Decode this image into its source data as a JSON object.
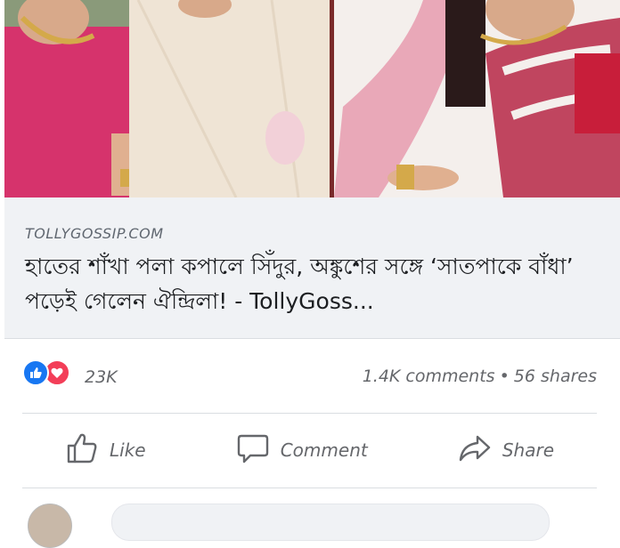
{
  "link_preview": {
    "domain": "TOLLYGOSSIP.COM",
    "headline": "হাতের শাঁখা পলা কপালে সিঁদুর, অঙ্কুশের সঙ্গে ‘সাতপাকে বাঁধা’ পড়েই গেলেন ঐন্দ্রিলা! - TollyGoss..."
  },
  "reactions": {
    "icons": [
      "like-icon",
      "love-icon"
    ],
    "count": "23K"
  },
  "stats": {
    "comments": "1.4K comments",
    "separator": "•",
    "shares": "56 shares"
  },
  "actions": {
    "like_label": "Like",
    "comment_label": "Comment",
    "share_label": "Share"
  },
  "colors": {
    "like_blue": "#1877f2",
    "love_red": "#f33e58",
    "text_gray": "#65676b",
    "card_bg": "#f0f2f5"
  }
}
